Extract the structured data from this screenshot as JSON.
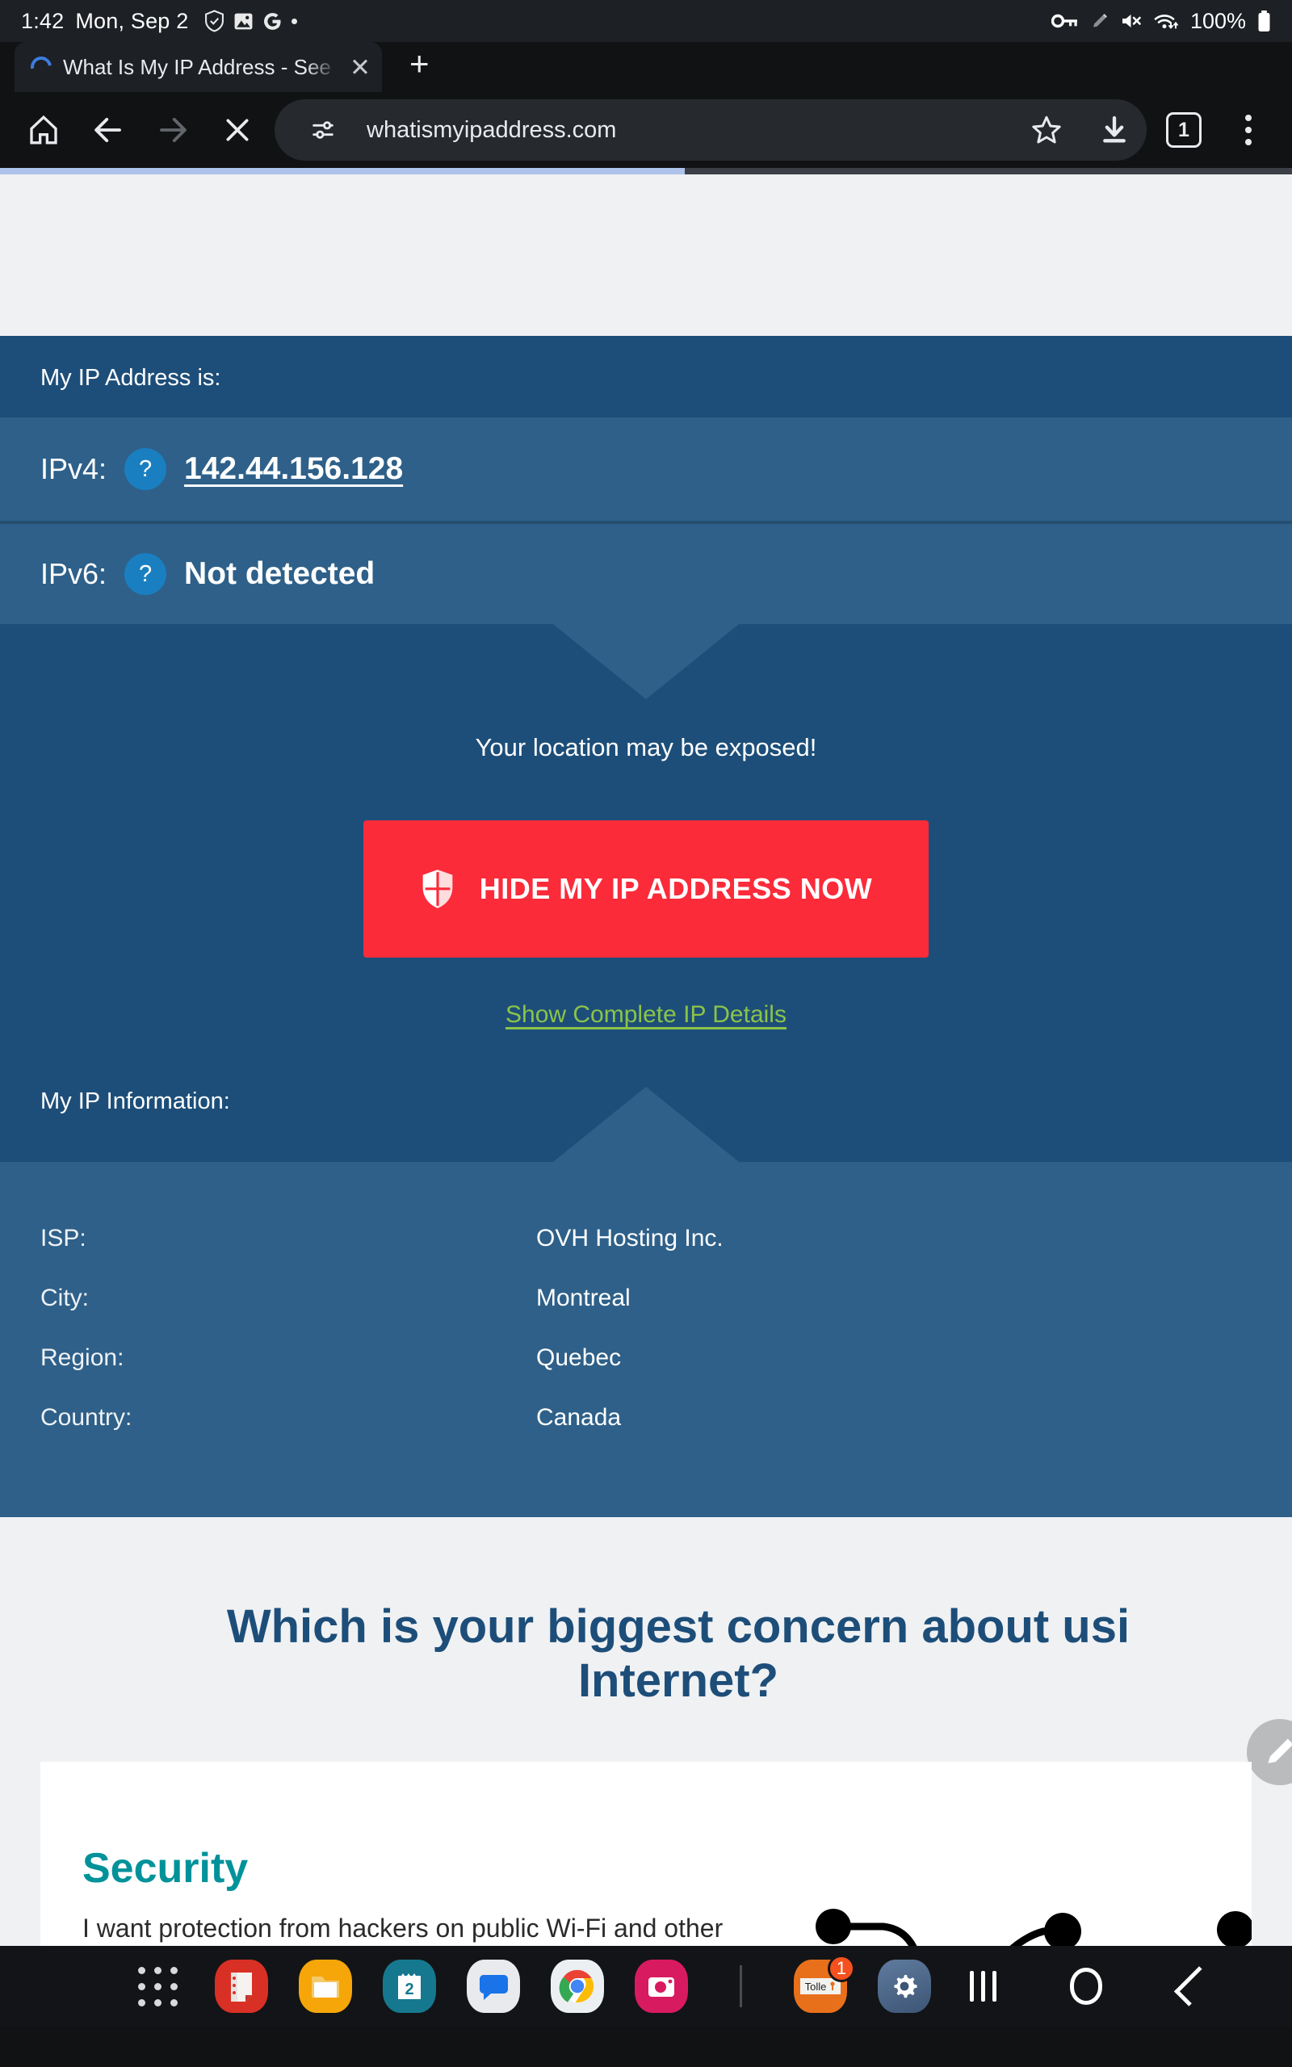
{
  "status_bar": {
    "time": "1:42",
    "date": "Mon, Sep 2",
    "battery_percent": "100%",
    "icons_left": [
      "shield-check-icon",
      "photo-icon",
      "google-icon",
      "dot-indicator"
    ],
    "icons_right": [
      "vpn-key-icon",
      "pencil-icon",
      "sound-muted-icon",
      "wifi-data-icon",
      "battery-full-icon"
    ]
  },
  "browser": {
    "tab": {
      "title": "What Is My IP Address - See",
      "loading": true,
      "close_label": "✕"
    },
    "new_tab_label": "+",
    "toolbar": {
      "home_icon": "home-icon",
      "back_icon": "back-arrow-icon",
      "forward_icon": "forward-arrow-icon",
      "stop_icon": "stop-loading-icon",
      "site_settings_icon": "tune-icon",
      "url": "whatismyipaddress.com",
      "bookmark_icon": "star-outline-icon",
      "download_icon": "download-icon",
      "tab_count": "1",
      "menu_icon": "three-dot-menu-icon"
    },
    "progress_percent": 53
  },
  "page": {
    "ip_header_label": "My IP Address is:",
    "ip_rows": [
      {
        "label": "IPv4:",
        "help": "?",
        "value": "142.44.156.128",
        "underlined": true
      },
      {
        "label": "IPv6:",
        "help": "?",
        "value": "Not detected",
        "underlined": false
      }
    ],
    "exposed_message": "Your location may be exposed!",
    "cta_label": "HIDE MY IP ADDRESS NOW",
    "cta_icon": "shield-icon",
    "details_link": "Show Complete IP Details",
    "info_header_label": "My IP Information:",
    "info_rows": [
      {
        "key": "ISP:",
        "value": "OVH Hosting Inc."
      },
      {
        "key": "City:",
        "value": "Montreal"
      },
      {
        "key": "Region:",
        "value": "Quebec"
      },
      {
        "key": "Country:",
        "value": "Canada"
      }
    ],
    "poll_title": "Which is your biggest concern about usi\nInternet?",
    "poll_card": {
      "title": "Security",
      "text": "I want protection from hackers on public Wi-Fi and other"
    },
    "fab_icon": "pencil-edit-icon",
    "colors": {
      "header_blue": "#1d4e79",
      "row_blue": "#2e6089",
      "cta_red": "#fb2b3a",
      "link_green": "#8bc34a",
      "card_teal": "#00929a",
      "page_gray": "#f0f1f3"
    }
  },
  "dock": {
    "apps": [
      {
        "name": "app-drawer",
        "label": ""
      },
      {
        "name": "samsung-notes",
        "label": ""
      },
      {
        "name": "my-files",
        "label": ""
      },
      {
        "name": "calendar",
        "label": "2"
      },
      {
        "name": "messages",
        "label": ""
      },
      {
        "name": "chrome",
        "label": ""
      },
      {
        "name": "camera",
        "label": ""
      },
      {
        "name": "tolle",
        "label": "Tolle",
        "badge": "1"
      },
      {
        "name": "settings",
        "label": ""
      }
    ],
    "nav": [
      {
        "name": "recents-button",
        "icon": "recents-icon"
      },
      {
        "name": "home-button",
        "icon": "home-pill-icon"
      },
      {
        "name": "back-button",
        "icon": "back-chevron-icon"
      }
    ]
  }
}
